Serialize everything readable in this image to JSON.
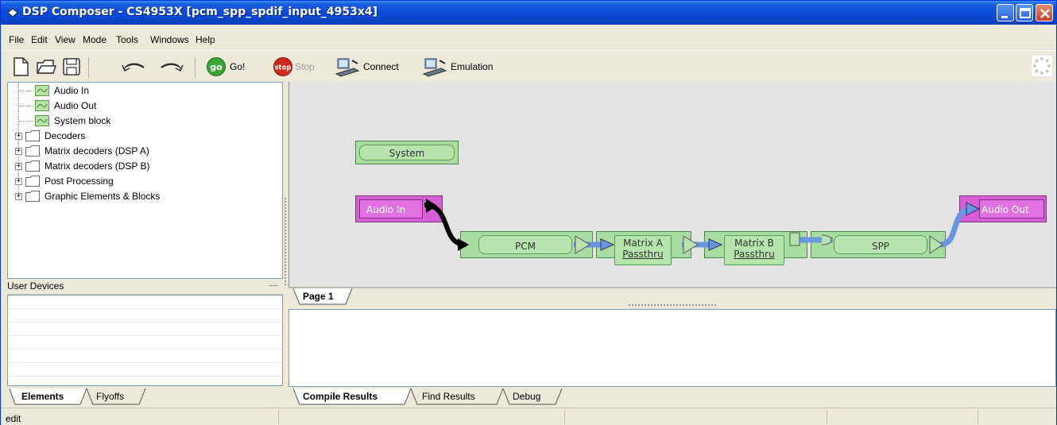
{
  "window": {
    "title": "DSP Composer - CS4953X [pcm_spp_spdif_input_4953x4]"
  },
  "menu": {
    "items": [
      "File",
      "Edit",
      "View",
      "Mode",
      "Tools",
      "Windows",
      "Help"
    ]
  },
  "toolbar": {
    "icons": [
      "new-file-icon",
      "open-folder-icon",
      "save-icon",
      "undo-icon",
      "redo-icon"
    ],
    "go_label": "Go!",
    "go_icon_text": "go",
    "stop_label": "Stop",
    "stop_icon_text": "stop",
    "connect_label": "Connect",
    "emulation_label": "Emulation"
  },
  "tree": {
    "items": [
      {
        "label": "Audio In",
        "type": "leaf"
      },
      {
        "label": "Audio Out",
        "type": "leaf"
      },
      {
        "label": "System block",
        "type": "leaf"
      },
      {
        "label": "Decoders",
        "type": "folder"
      },
      {
        "label": "Matrix decoders (DSP A)",
        "type": "folder"
      },
      {
        "label": "Matrix decoders (DSP B)",
        "type": "folder"
      },
      {
        "label": "Post Processing",
        "type": "folder"
      },
      {
        "label": "Graphic Elements & Blocks",
        "type": "folder"
      }
    ]
  },
  "user_devices": {
    "title": "User Devices",
    "collapse": "—"
  },
  "left_tabs": [
    "Elements",
    "Flyoffs"
  ],
  "diagram": {
    "blocks": {
      "system": "System",
      "audio_in": "Audio In",
      "pcm": "PCM",
      "matrix_a_line1": "Matrix A",
      "matrix_a_line2": "Passthru",
      "matrix_b_line1": "Matrix B",
      "matrix_b_line2": "Passthru",
      "spp": "SPP",
      "audio_out": "Audio Out"
    },
    "colors": {
      "green_block": "#a9dca0",
      "purple_block": "#d55dd5",
      "blue_wire": "#6a95e0",
      "black_wire": "#000000"
    }
  },
  "page_tabs": [
    "Page 1"
  ],
  "bottom_tabs": [
    "Compile Results",
    "Find Results",
    "Debug"
  ],
  "status": {
    "text": "edit"
  }
}
